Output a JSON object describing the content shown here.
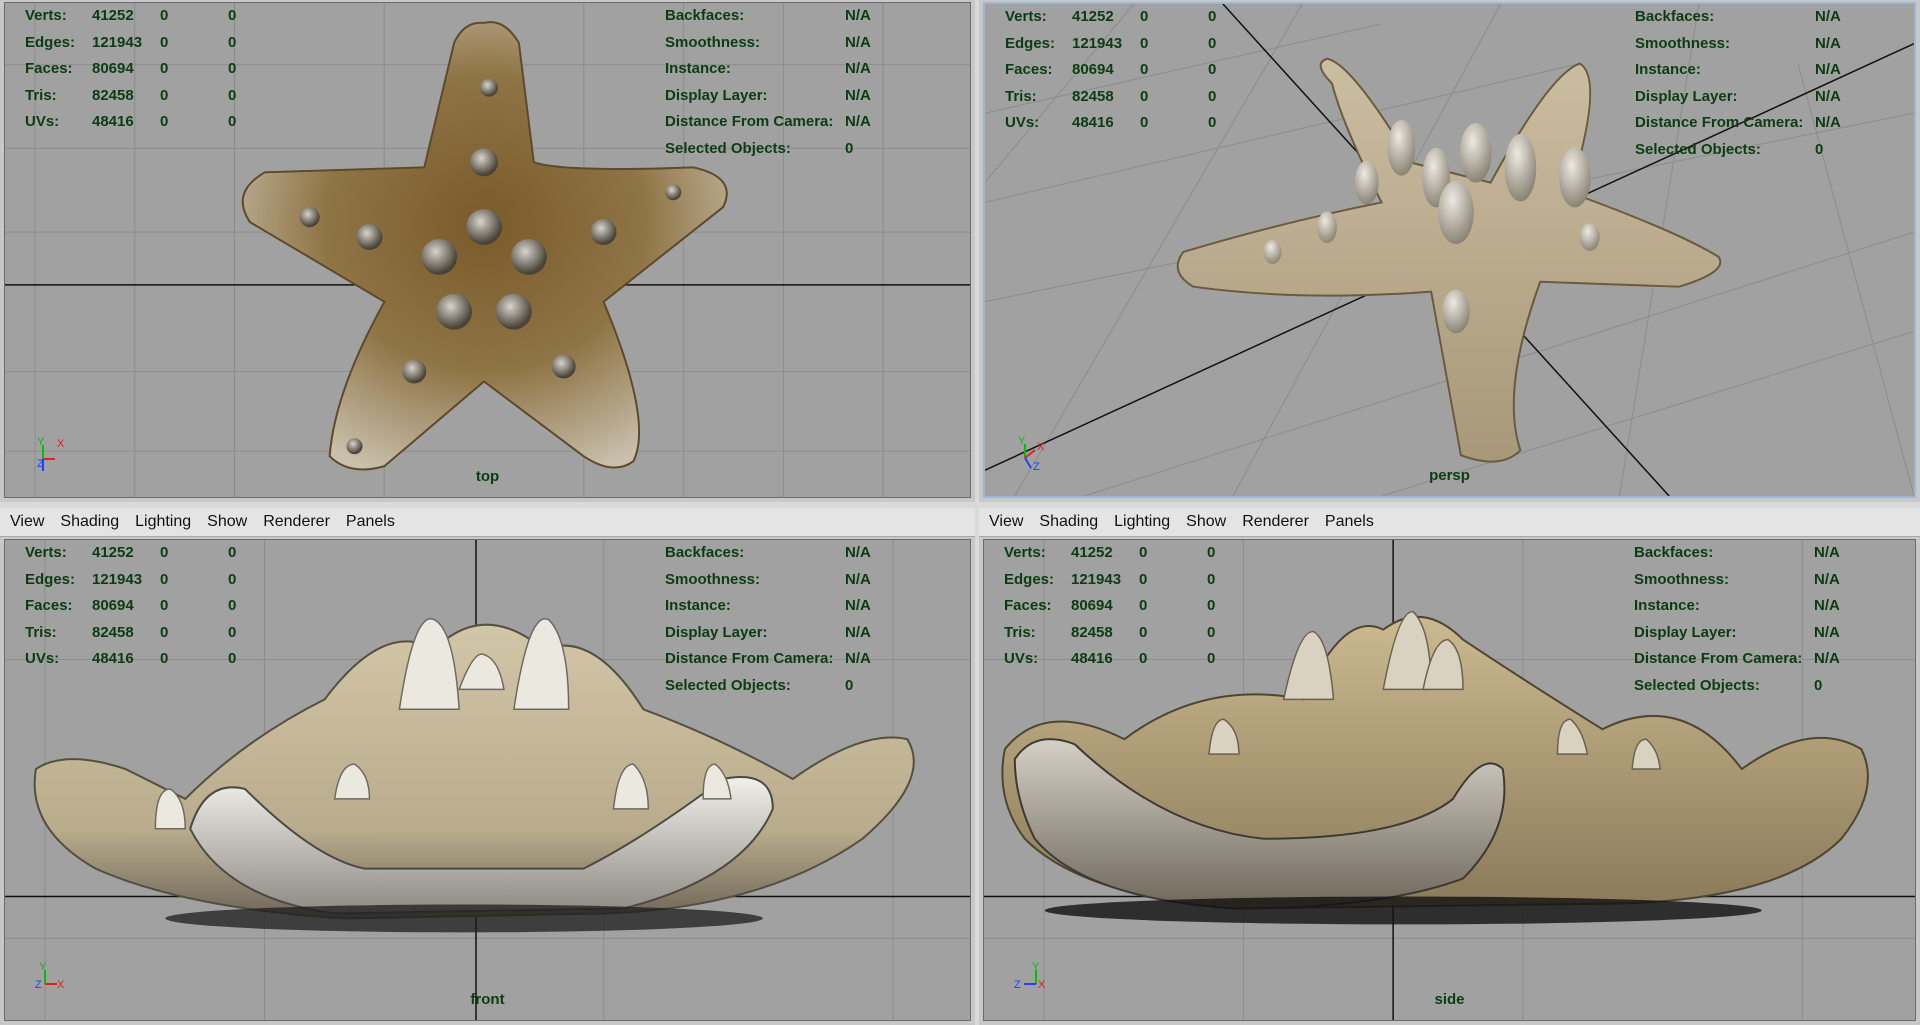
{
  "menu": [
    "View",
    "Shading",
    "Lighting",
    "Show",
    "Renderer",
    "Panels"
  ],
  "hud_left": [
    {
      "label": "Verts:",
      "value": "41252",
      "a": "0",
      "b": "0"
    },
    {
      "label": "Edges:",
      "value": "121943",
      "a": "0",
      "b": "0"
    },
    {
      "label": "Faces:",
      "value": "80694",
      "a": "0",
      "b": "0"
    },
    {
      "label": "Tris:",
      "value": "82458",
      "a": "0",
      "b": "0"
    },
    {
      "label": "UVs:",
      "value": "48416",
      "a": "0",
      "b": "0"
    }
  ],
  "hud_right": [
    {
      "label": "Backfaces:",
      "value": "N/A"
    },
    {
      "label": "Smoothness:",
      "value": "N/A"
    },
    {
      "label": "Instance:",
      "value": "N/A"
    },
    {
      "label": "Display Layer:",
      "value": "N/A"
    },
    {
      "label": "Distance From Camera:",
      "value": "N/A"
    },
    {
      "label": "Selected Objects:",
      "value": "0"
    }
  ],
  "views": {
    "top": "top",
    "persp": "persp",
    "front": "front",
    "side": "side"
  },
  "axes": {
    "top": [
      "Y",
      "X",
      "Z"
    ],
    "persp": [
      "Y",
      "X",
      "Z"
    ],
    "front": [
      "Y",
      "Z",
      "X"
    ],
    "side": [
      "Y",
      "Z",
      "X"
    ]
  },
  "colors": {
    "hud_text": "#0c3d12",
    "viewport_bg": "#a1a1a1",
    "grid": "#8a8a8a",
    "axis_y": "#00c000",
    "axis_x": "#e02020",
    "axis_z": "#2040ff"
  }
}
